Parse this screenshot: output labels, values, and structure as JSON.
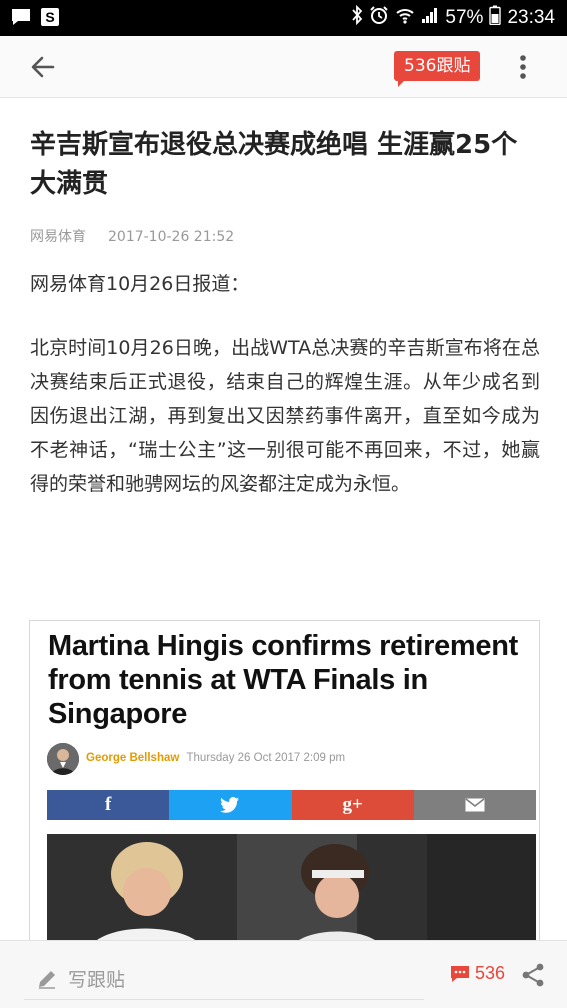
{
  "status_bar": {
    "battery": "57%",
    "time": "23:34"
  },
  "toolbar": {
    "comment_badge": "536跟贴"
  },
  "article": {
    "title": "辛吉斯宣布退役总决赛成绝唱 生涯赢25个大满贯",
    "source": "网易体育",
    "datetime": "2017-10-26 21:52",
    "para1": "网易体育10月26日报道：",
    "para2": "北京时间10月26日晚，出战WTA总决赛的辛吉斯宣布将在总决赛结束后正式退役，结束自己的辉煌生涯。从年少成名到因伤退出江湖，再到复出又因禁药事件离开，直至如今成为不老神话，“瑞士公主”这一别很可能不再回来，不过，她赢得的荣誉和驰骋网坛的风姿都注定成为永恒。"
  },
  "embed": {
    "headline": "Martina Hingis confirms retirement from tennis at WTA Finals in Singapore",
    "author": "George Bellshaw",
    "date": "Thursday 26 Oct 2017 2:09 pm",
    "share": {
      "facebook": "f",
      "google": "g+"
    }
  },
  "bottom_bar": {
    "write_label": "写跟贴",
    "comment_count": "536"
  },
  "colors": {
    "accent": "#e8473c",
    "author": "#e59b00",
    "facebook": "#3b5998",
    "twitter": "#1da1f2",
    "google": "#dd4b39",
    "email": "#7f7f7f"
  },
  "icons": {
    "statusbar_left": [
      "chat-icon",
      "s-app-icon"
    ],
    "statusbar_right": [
      "bluetooth-icon",
      "alarm-icon",
      "wifi-icon",
      "signal-icon",
      "battery-icon"
    ],
    "toolbar": [
      "back-arrow-icon",
      "more-vert-icon"
    ],
    "bottom": [
      "pencil-icon",
      "comment-icon",
      "share-icon"
    ]
  }
}
